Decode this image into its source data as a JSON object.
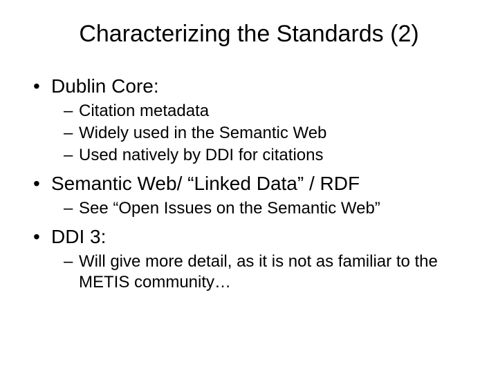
{
  "title": "Characterizing the Standards (2)",
  "bullets": [
    {
      "label": "Dublin Core:",
      "sub": [
        "Citation metadata",
        "Widely used in the Semantic Web",
        "Used natively by DDI for citations"
      ]
    },
    {
      "label": "Semantic Web/ “Linked Data” / RDF",
      "sub": [
        "See “Open Issues on the Semantic Web”"
      ]
    },
    {
      "label": "DDI 3:",
      "sub": [
        "Will give more detail, as it is not as familiar to the METIS community…"
      ]
    }
  ]
}
